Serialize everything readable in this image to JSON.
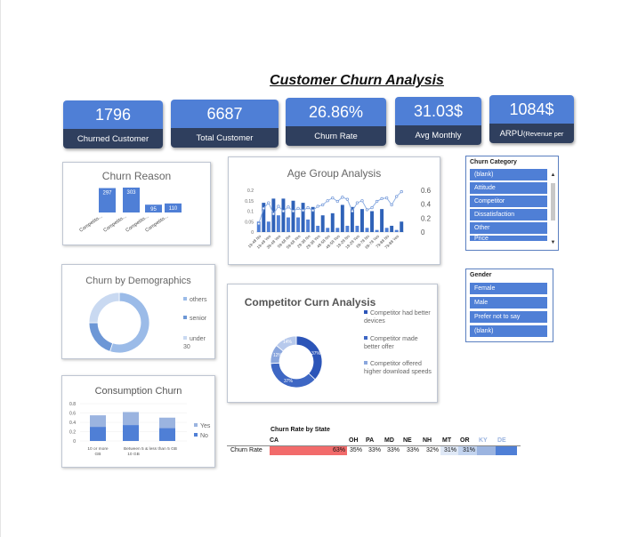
{
  "title": "Customer Churn Analysis",
  "kpis": [
    {
      "value": "1796",
      "label": "Churned Customer"
    },
    {
      "value": "6687",
      "label": "Total Customer"
    },
    {
      "value": "26.86%",
      "label": "Churn Rate"
    },
    {
      "value": "31.03$",
      "label": "Avg Monthly"
    },
    {
      "value": "1084$",
      "label_main": "ARPU",
      "label_small": "(Revenue per"
    }
  ],
  "colors": {
    "accent": "#4f7fd6",
    "dark": "#2f3f5e",
    "red": "#f26b6b",
    "light_blue": "#9bb4e0"
  },
  "churn_reason": {
    "title": "Churn Reason",
    "categories": [
      "Competito...",
      "Competito...",
      "Competito...",
      "Competito..."
    ],
    "values": [
      297,
      303,
      95,
      110
    ]
  },
  "age_group": {
    "title": "Age Group Analysis",
    "left_ticks": [
      "0.2",
      "0.15",
      "0.1",
      "0.05",
      "0"
    ],
    "right_ticks": [
      "0.6",
      "0.4",
      "0.2",
      "0"
    ],
    "categories": [
      "19-48 No",
      "19-48 Yes",
      "39-48 Yes",
      "59-68 No",
      "59-68 Yes",
      "29-38 No",
      "29-38 Yes",
      "49-58 No",
      "49-58 Yes",
      "19-28 No",
      "19-28 Yes",
      "69-78 No",
      "69-78 Yes",
      "79-88 No",
      "79-88 Yes"
    ],
    "bars": [
      0.05,
      0.14,
      0.05,
      0.16,
      0.08,
      0.16,
      0.07,
      0.15,
      0.07,
      0.14,
      0.06,
      0.12,
      0.03,
      0.08,
      0.02,
      0.09,
      0.02,
      0.13,
      0.03,
      0.12,
      0.03,
      0.11,
      0.02,
      0.1,
      0.01,
      0.11,
      0.02,
      0.03,
      0.01,
      0.05
    ],
    "line": [
      0.12,
      0.34,
      0.42,
      0.26,
      0.37,
      0.3,
      0.36,
      0.3,
      0.34,
      0.31,
      0.35,
      0.31,
      0.37,
      0.39,
      0.45,
      0.49,
      0.44,
      0.5,
      0.47,
      0.3,
      0.42,
      0.45,
      0.32,
      0.35,
      0.44,
      0.48,
      0.49,
      0.39,
      0.51,
      0.58
    ]
  },
  "churn_category": {
    "title": "Churn Category",
    "items": [
      "(blank)",
      "Attitude",
      "Competitor",
      "Dissatisfaction",
      "Other",
      "Price"
    ]
  },
  "gender": {
    "title": "Gender",
    "items": [
      "Female",
      "Male",
      "Prefer not to say",
      "(blank)"
    ]
  },
  "demographics": {
    "title": "Churn by Demographics",
    "legend": [
      "others",
      "senior",
      "under 30"
    ],
    "values": [
      0.55,
      0.2,
      0.25
    ],
    "colors": [
      "#9bbbe8",
      "#6d97d6",
      "#c9d9f1"
    ]
  },
  "competitor": {
    "title": "Competitor Curn Analysis",
    "legend": [
      "Competitor had better devices",
      "Competitor made better offer",
      "Competitor offered higher download speeds"
    ],
    "slice_labels": [
      "37%",
      "37%",
      "12%",
      "14%"
    ],
    "values": [
      0.37,
      0.37,
      0.12,
      0.14
    ],
    "colors": [
      "#2c55b8",
      "#3e67c4",
      "#8aa6dd",
      "#b7c9ec"
    ]
  },
  "consumption": {
    "title": "Consumption Churn",
    "y_ticks": [
      "0.8",
      "0.6",
      "0.4",
      "0.2",
      "0"
    ],
    "categories": [
      "10 or more GB",
      "Between 5 & less than 5 GB",
      "10 GB"
    ],
    "x_labels": [
      "10 or more\nGB",
      "Between 5 & less than 5 GB\n10 GB"
    ],
    "values": [
      0.55,
      0.62,
      0.5
    ],
    "legend": [
      "Yes",
      "No"
    ]
  },
  "state_table": {
    "title": "Churn Rate by State",
    "row_label": "Churn Rate",
    "states": [
      "CA",
      "OH",
      "PA",
      "MD",
      "NE",
      "NH",
      "MT",
      "OR",
      "KY",
      "DE"
    ],
    "values": [
      "63%",
      "35%",
      "33%",
      "33%",
      "33%",
      "32%",
      "31%",
      "31%",
      "",
      ""
    ]
  }
}
